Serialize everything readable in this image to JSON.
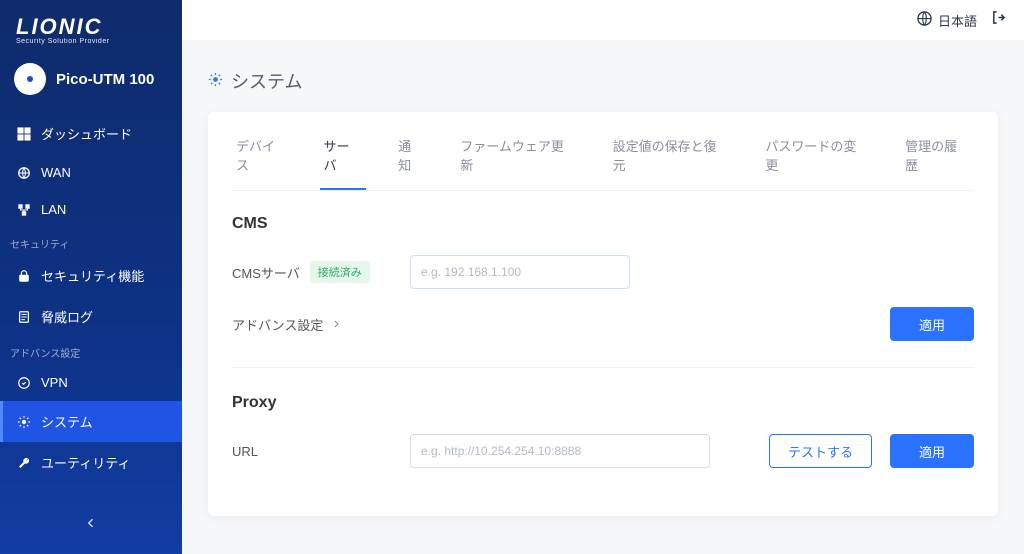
{
  "brand": {
    "name": "LIONIC",
    "tagline": "Security Solution Provider"
  },
  "product": {
    "name": "Pico-UTM 100"
  },
  "topbar": {
    "language_label": "日本語"
  },
  "sidebar": {
    "items": {
      "dashboard": {
        "label": "ダッシュボード"
      },
      "wan": {
        "label": "WAN"
      },
      "lan": {
        "label": "LAN"
      },
      "secfeat": {
        "label": "セキュリティ機能"
      },
      "threatlog": {
        "label": "脅威ログ"
      },
      "vpn": {
        "label": "VPN"
      },
      "system": {
        "label": "システム"
      },
      "utility": {
        "label": "ユーティリティ"
      }
    },
    "section_security": "セキュリティ",
    "section_advanced": "アドバンス設定"
  },
  "page": {
    "title": "システム"
  },
  "tabs": {
    "device": "デバイス",
    "server": "サーバ",
    "notify": "通知",
    "firmware": "ファームウェア更新",
    "backup": "設定値の保存と復元",
    "password": "パスワードの変更",
    "history": "管理の履歴"
  },
  "cms": {
    "section_title": "CMS",
    "server_label": "CMSサーバ",
    "status_badge": "接続済み",
    "placeholder": "e.g. 192.168.1.100",
    "value": "",
    "advanced_label": "アドバンス設定",
    "apply_label": "適用"
  },
  "proxy": {
    "section_title": "Proxy",
    "url_label": "URL",
    "placeholder": "e.g. http://10.254.254.10:8888",
    "value": "",
    "test_label": "テストする",
    "apply_label": "適用"
  }
}
